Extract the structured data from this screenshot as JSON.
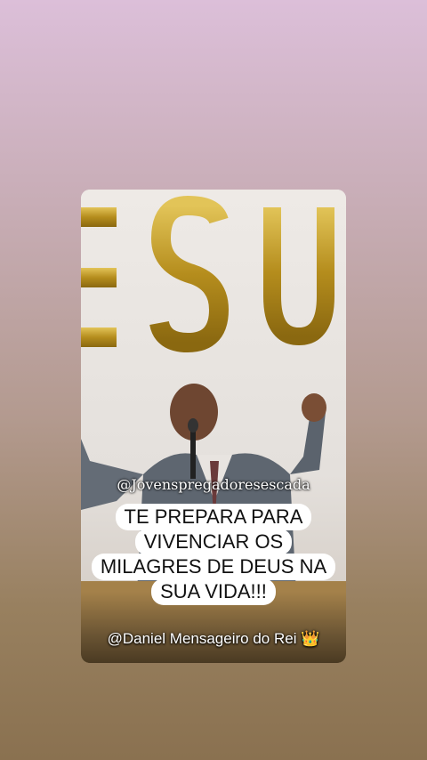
{
  "post": {
    "watermark": "@Jovenspregadoresescada",
    "caption_lines": [
      "TE PREPARA PARA",
      "VIVENCIAR OS",
      "MILAGRES DE DEUS NA",
      "SUA VIDA!!!"
    ],
    "credit": "@Daniel Mensageiro do Rei",
    "credit_emoji": "👑",
    "wall_letters": "ESU"
  },
  "colors": {
    "gold": "#c9a227",
    "caption_bg": "#ffffff"
  }
}
